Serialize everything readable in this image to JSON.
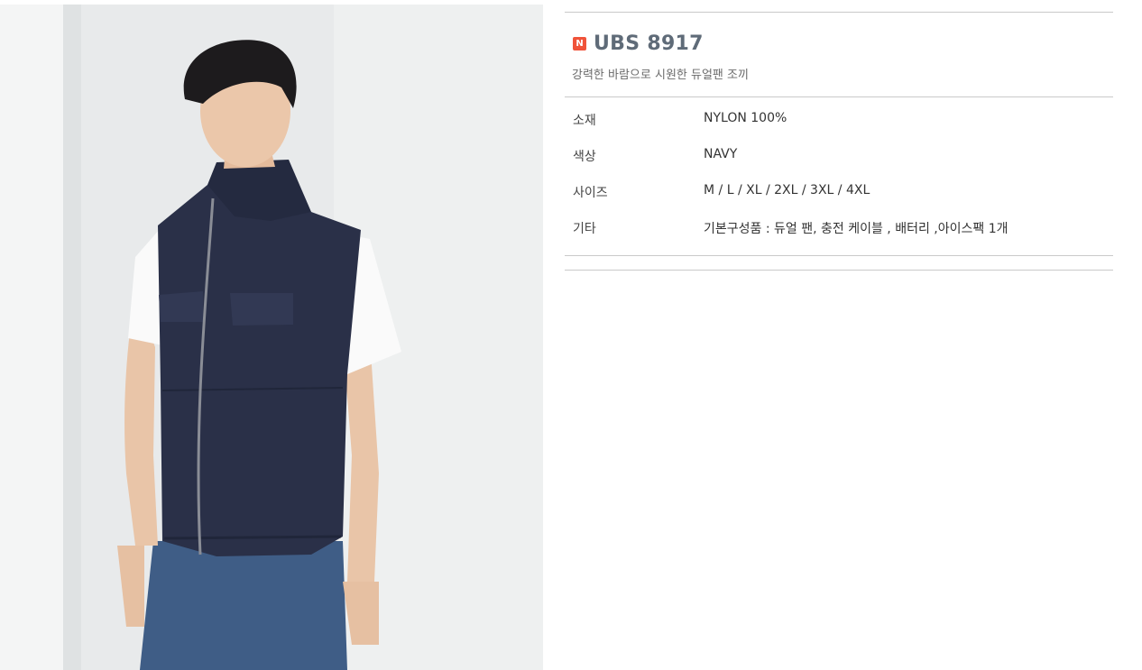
{
  "product": {
    "badge": "N",
    "title": "UBS 8917",
    "subtitle": "강력한 바람으로 시원한 듀얼팬 조끼",
    "specs": [
      {
        "label": "소재",
        "value": "NYLON 100%"
      },
      {
        "label": "색상",
        "value": "NAVY"
      },
      {
        "label": "사이즈",
        "value": "M / L / XL / 2XL / 3XL / 4XL"
      },
      {
        "label": "기타",
        "value": "기본구성품 : 듀얼 팬, 충전 케이블 , 배터리 ,아이스팩 1개"
      }
    ]
  },
  "colors": {
    "badge": "#f0533a",
    "title": "#5f6b78",
    "vest": "#2a3048"
  }
}
